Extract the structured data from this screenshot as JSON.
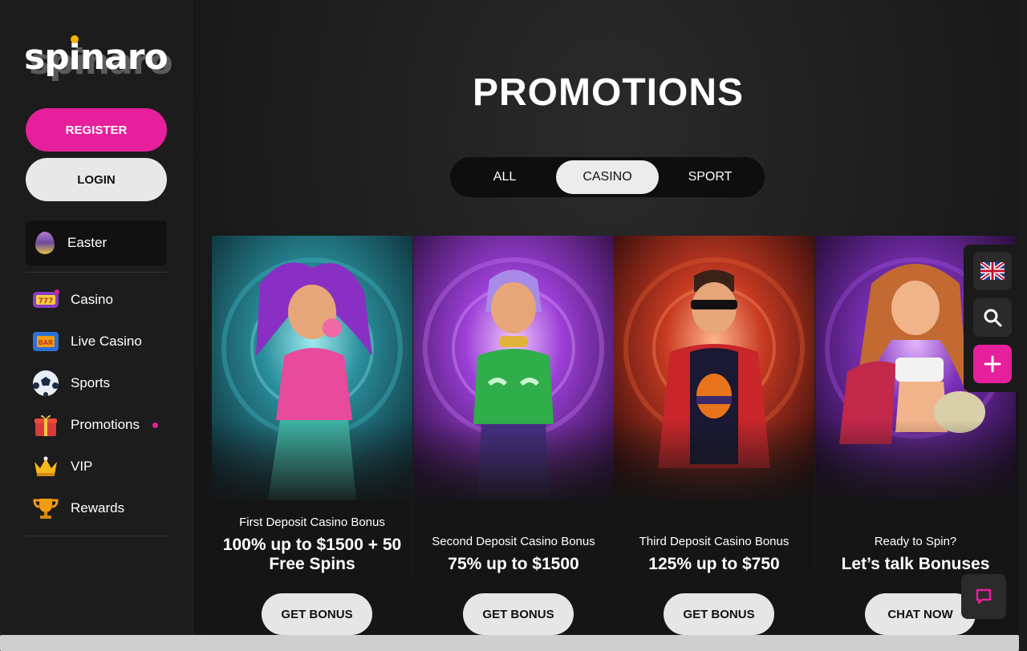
{
  "brand": {
    "name": "spinaro"
  },
  "auth": {
    "register_label": "REGISTER",
    "login_label": "LOGIN"
  },
  "featured": {
    "label": "Easter",
    "icon": "easter-egg-icon"
  },
  "nav": [
    {
      "label": "Casino",
      "icon": "slot-machine-icon"
    },
    {
      "label": "Live Casino",
      "icon": "bar-slot-icon"
    },
    {
      "label": "Sports",
      "icon": "soccer-ball-icon"
    },
    {
      "label": "Promotions",
      "icon": "gift-box-icon",
      "active": true
    },
    {
      "label": "VIP",
      "icon": "crown-icon"
    },
    {
      "label": "Rewards",
      "icon": "trophy-icon"
    }
  ],
  "page": {
    "title": "PROMOTIONS"
  },
  "tabs": [
    {
      "label": "ALL"
    },
    {
      "label": "CASINO",
      "active": true
    },
    {
      "label": "SPORT"
    }
  ],
  "cards": [
    {
      "subtitle": "First Deposit Casino Bonus",
      "headline": "100% up to $1500 + 50 Free Spins",
      "cta": "GET BONUS"
    },
    {
      "subtitle": "Second Deposit Casino Bonus",
      "headline": "75% up to $1500",
      "cta": "GET BONUS"
    },
    {
      "subtitle": "Third Deposit Casino Bonus",
      "headline": "125% up to $750",
      "cta": "GET BONUS"
    },
    {
      "subtitle": "Ready to Spin?",
      "headline": "Let’s talk Bonuses",
      "cta": "CHAT NOW"
    }
  ],
  "rail": {
    "language_icon": "uk-flag-icon",
    "search_icon": "search-icon",
    "add_icon": "plus-icon"
  },
  "chat": {
    "icon": "chat-bubble-icon"
  },
  "colors": {
    "accent": "#e61f9c",
    "sidebar_bg": "#1c1c1c",
    "main_bg": "#1b1b1b"
  }
}
